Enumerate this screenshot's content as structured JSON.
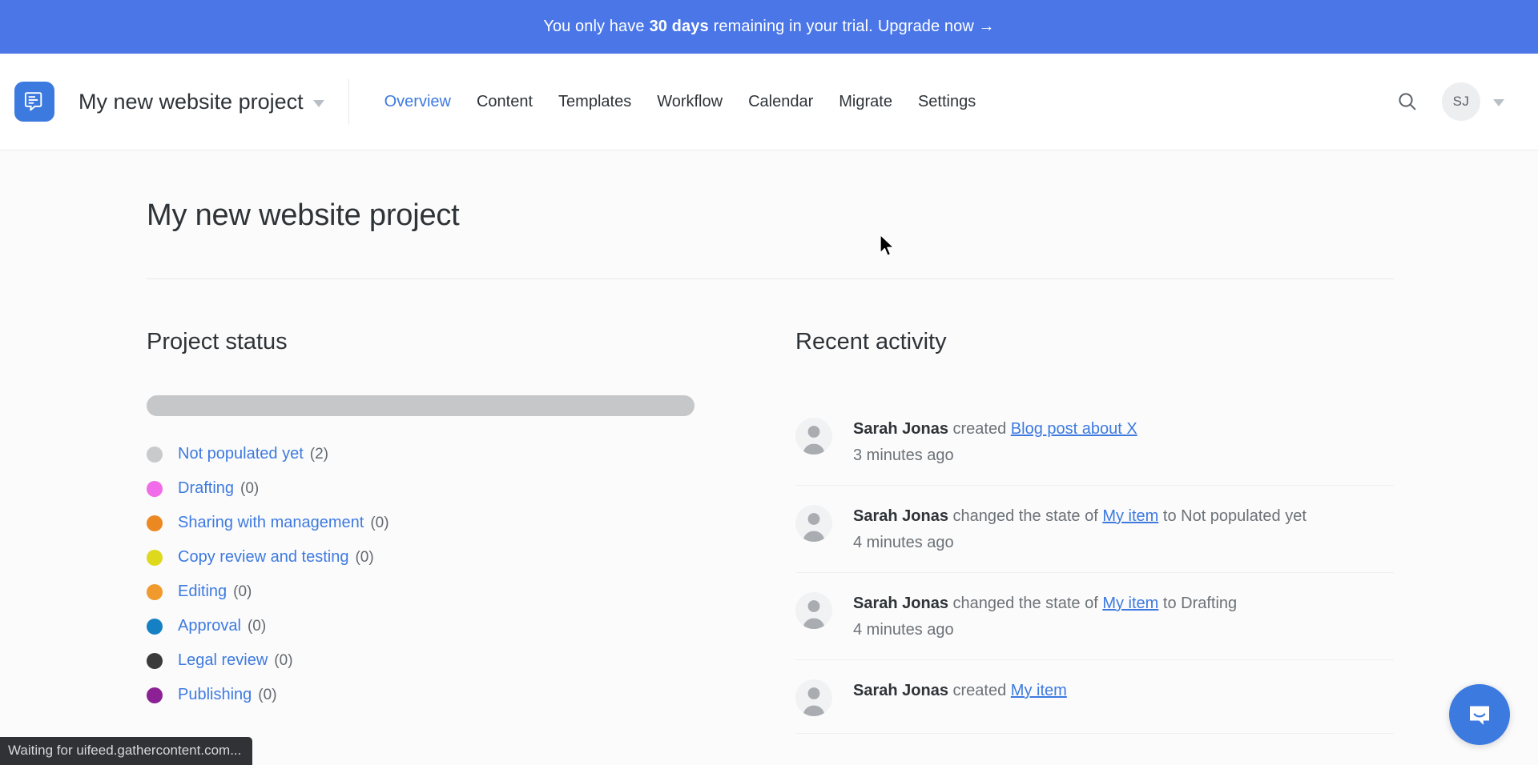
{
  "banner": {
    "text_pre": "You only have",
    "days": "30 days",
    "text_post": "remaining in your trial.",
    "upgrade_label": "Upgrade now →"
  },
  "header": {
    "logo_icon": "gathercontent-document-icon",
    "project_name": "My new website project",
    "project_caret_icon": "chevron-down-icon",
    "search_icon": "search-icon",
    "avatar_initials": "SJ",
    "avatar_caret_icon": "chevron-down-icon",
    "nav": [
      {
        "label": "Overview",
        "active": true
      },
      {
        "label": "Content",
        "active": false
      },
      {
        "label": "Templates",
        "active": false
      },
      {
        "label": "Workflow",
        "active": false
      },
      {
        "label": "Calendar",
        "active": false
      },
      {
        "label": "Migrate",
        "active": false
      },
      {
        "label": "Settings",
        "active": false
      }
    ]
  },
  "page": {
    "title": "My new website project"
  },
  "project_status": {
    "title": "Project status",
    "progress_percent": 100,
    "progress_color": "#c6c7c9",
    "statuses": [
      {
        "label": "Not populated yet",
        "count": "(2)",
        "color": "#c9cacc"
      },
      {
        "label": "Drafting",
        "count": "(0)",
        "color": "#f06ce8"
      },
      {
        "label": "Sharing with management",
        "count": "(0)",
        "color": "#ec8822"
      },
      {
        "label": "Copy review and testing",
        "count": "(0)",
        "color": "#dfd91e"
      },
      {
        "label": "Editing",
        "count": "(0)",
        "color": "#f09a2e"
      },
      {
        "label": "Approval",
        "count": "(0)",
        "color": "#1581c4"
      },
      {
        "label": "Legal review",
        "count": "(0)",
        "color": "#3b3b3b"
      },
      {
        "label": "Publishing",
        "count": "(0)",
        "color": "#8b2194"
      }
    ]
  },
  "recent_activity": {
    "title": "Recent activity",
    "items": [
      {
        "actor": "Sarah Jonas",
        "verb": "created",
        "target": "Blog post about X",
        "suffix": "",
        "time": "3 minutes ago"
      },
      {
        "actor": "Sarah Jonas",
        "verb": "changed the state of",
        "target": "My item",
        "suffix": "to Not populated yet",
        "time": "4 minutes ago"
      },
      {
        "actor": "Sarah Jonas",
        "verb": "changed the state of",
        "target": "My item",
        "suffix": "to Drafting",
        "time": "4 minutes ago"
      },
      {
        "actor": "Sarah Jonas",
        "verb": "created",
        "target": "My item",
        "suffix": "",
        "time": ""
      }
    ]
  },
  "intercom": {
    "icon": "chat-bubble-icon"
  },
  "browser_status": {
    "text": "Waiting for uifeed.gathercontent.com..."
  }
}
